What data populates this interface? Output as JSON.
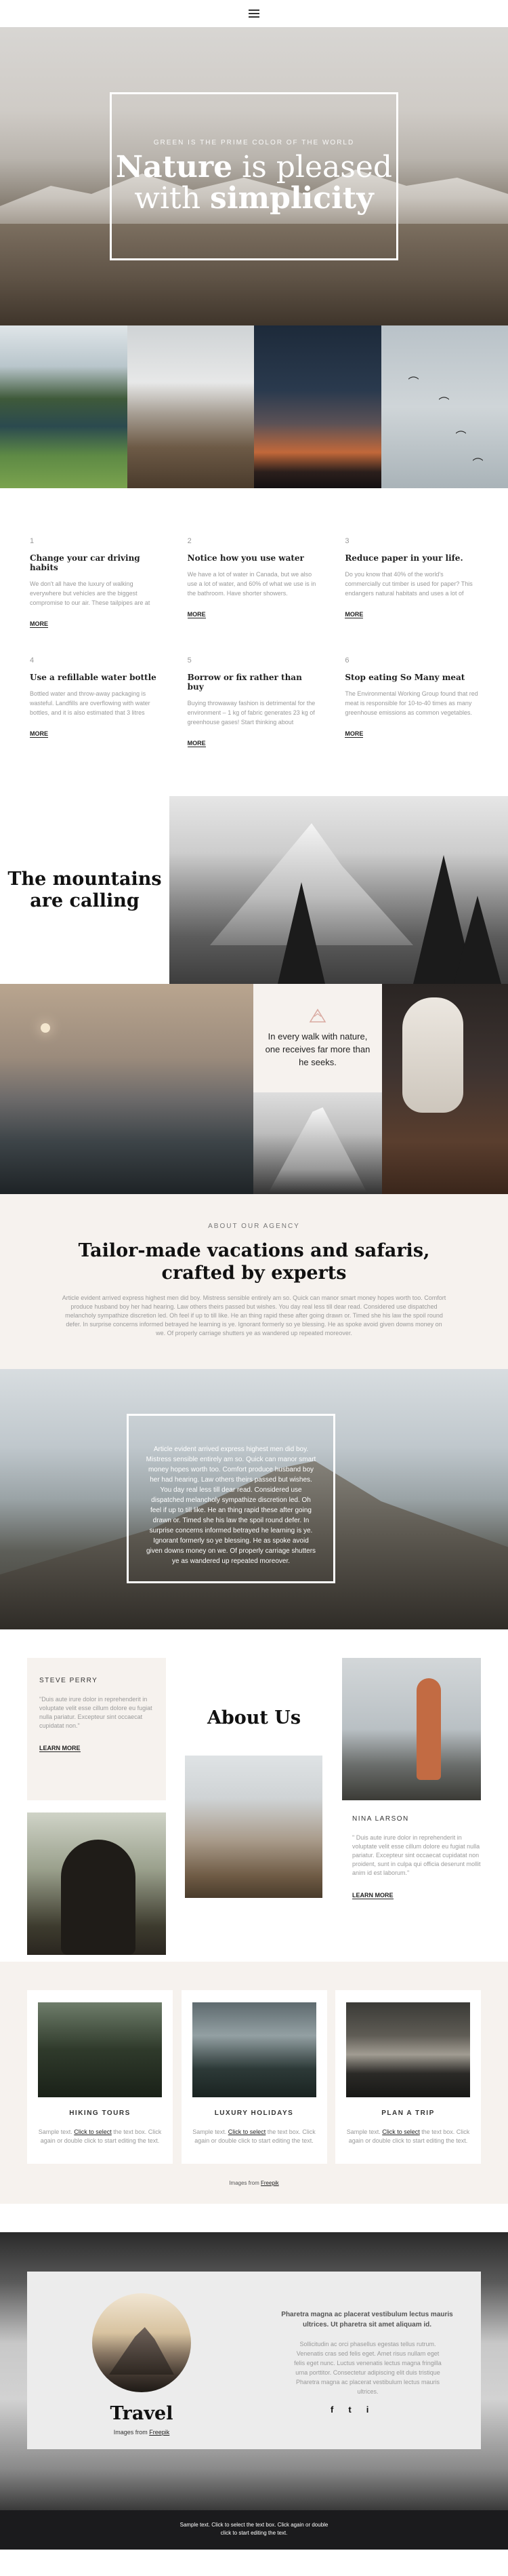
{
  "header": {
    "menu_icon": "hamburger-menu-icon"
  },
  "hero": {
    "eyebrow": "GREEN IS THE PRIME COLOR OF THE WORLD",
    "title_line1": "Nature",
    "title_line1_rest": " is pleased",
    "title_line2": "with ",
    "title_line2_bold": "simplicity"
  },
  "tips": [
    {
      "num": "1",
      "title": "Change your car driving habits",
      "text": "We don't all have the luxury of walking everywhere but vehicles are the biggest compromise to our air. These tailpipes are at street level",
      "more": "MORE"
    },
    {
      "num": "2",
      "title": "Notice how you use water",
      "text": "We have a lot of water in Canada, but we also use a lot of water, and 60% of what we use is in the bathroom. Have shorter showers.",
      "more": "MORE"
    },
    {
      "num": "3",
      "title": "Reduce paper in your life.",
      "text": "Do you know that 40% of the world's commercially cut timber is used for paper? This endangers natural habitats and uses a lot of water.",
      "more": "MORE"
    },
    {
      "num": "4",
      "title": "Use a refillable water bottle",
      "text": "Bottled water and throw-away packaging is wasteful. Landfills are overflowing with water bottles, and it is also estimated that 3 litres",
      "more": "MORE"
    },
    {
      "num": "5",
      "title": "Borrow or fix rather than buy",
      "text": "Buying throwaway fashion is detrimental for the environment – 1 kg of fabric generates 23 kg of greenhouse gases! Start thinking about",
      "more": "MORE"
    },
    {
      "num": "6",
      "title": "Stop eating So Many meat",
      "text": "The Environmental Working Group found that red meat is responsible for 10-to-40 times as many greenhouse emissions as common vegetables.",
      "more": "MORE"
    }
  ],
  "calling": {
    "title": "The mountains are calling"
  },
  "gallery": {
    "quote": "In every walk with nature, one receives far more than he seeks."
  },
  "agency": {
    "eyebrow": "ABOUT OUR AGENCY",
    "title": "Tailor-made vacations and safaris, crafted by experts",
    "text": "Article evident arrived express highest men did boy. Mistress sensible entirely am so. Quick can manor smart money hopes worth too. Comfort produce husband boy her had hearing. Law others theirs passed but wishes. You day real less till dear read. Considered use dispatched melancholy sympathize discretion led. Oh feel if up to till like. He an thing rapid these after going drawn or. Timed she his law the spoil round defer. In surprise concerns informed betrayed he learning is ye. Ignorant formerly so ye blessing. He as spoke avoid given downs money on we. Of properly carriage shutters ye as wandered up repeated moreover."
  },
  "mountain_quote": {
    "text": "Article evident arrived express highest men did boy. Mistress sensible entirely am so. Quick can manor smart money hopes worth too. Comfort produce husband boy her had hearing. Law others theirs passed but wishes. You day real less till dear read. Considered use dispatched melancholy sympathize discretion led. Oh feel if up to till like. He an thing rapid these after going drawn or. Timed she his law the spoil round defer. In surprise concerns informed betrayed he learning is ye. Ignorant formerly so ye blessing. He as spoke avoid given downs money on we. Of properly carriage shutters ye as wandered up repeated moreover."
  },
  "team": {
    "about_title": "About Us",
    "steve": {
      "name": "STEVE PERRY",
      "text": "\"Duis aute irure dolor in reprehenderit in voluptate velit esse cillum dolore eu fugiat nulla pariatur. Excepteur sint occaecat cupidatat non.\"",
      "more": "LEARN MORE"
    },
    "nina": {
      "name": "NINA LARSON",
      "text": "\" Duis aute irure dolor in reprehenderit in voluptate velit esse cillum dolore eu fugiat nulla pariatur. Excepteur sint occaecat cupidatat non proident, sunt in culpa qui officia deserunt mollit anim id est laborum.\"",
      "more": "LEARN MORE"
    }
  },
  "services": {
    "items": [
      {
        "title": "HIKING TOURS"
      },
      {
        "title": "LUXURY HOLIDAYS"
      },
      {
        "title": "PLAN A TRIP"
      }
    ],
    "text_pre": "Sample text. ",
    "text_link": "Click to select",
    "text_post": " the text box. Click again or double click to start editing the text.",
    "credit_pre": "Images from ",
    "credit_link": "Freepik"
  },
  "travel": {
    "title": "Travel",
    "sub_pre": "Images from ",
    "sub_link": "Freepik",
    "heading": "Pharetra magna ac placerat vestibulum lectus mauris ultrices. Ut pharetra sit amet aliquam id.",
    "text": "Sollicitudin ac orci phasellus egestas tellus rutrum. Venenatis cras sed felis eget. Amet risus nullam eget felis eget nunc. Luctus venenatis lectus magna fringilla urna porttitor. Consectetur adipiscing elit duis tristique Pharetra magna ac placerat vestibulum lectus mauris ultrices.",
    "social": [
      "f",
      "t",
      "i"
    ]
  },
  "footer": {
    "line1": "Sample text. Click to select the text box. Click again or double",
    "line2": "click to start editing the text."
  }
}
